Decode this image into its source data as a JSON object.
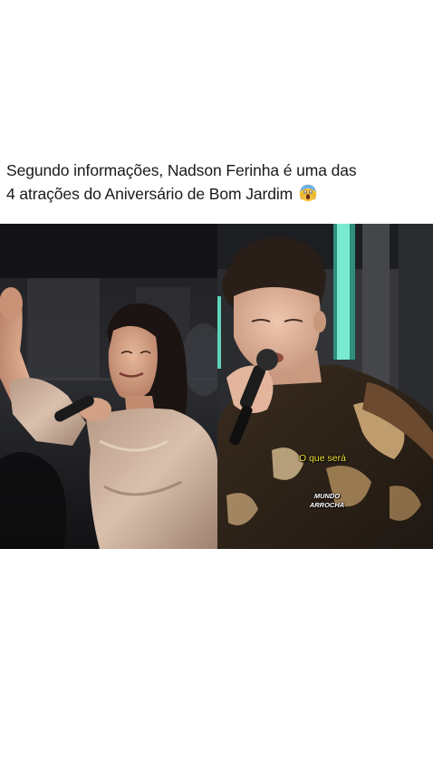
{
  "post": {
    "text_line_1": "Segundo informações, Nadson Ferinha é uma das",
    "text_line_2": "4 atrações do Aniversário de Bom Jardim",
    "emoji": "screaming-face-emoji"
  },
  "media": {
    "caption": "O que será",
    "watermark_line_1": "MUNDO",
    "watermark_line_2": "ARROCHA"
  },
  "colors": {
    "caption": "#f4e63a",
    "text": "#1a1a1a",
    "background": "#ffffff"
  }
}
